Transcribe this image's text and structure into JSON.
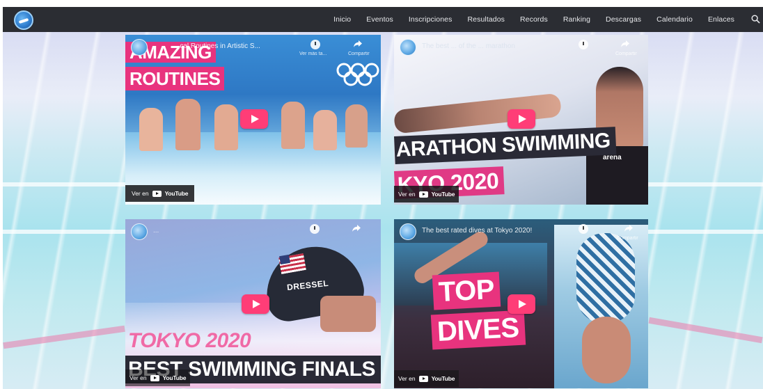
{
  "navbar": {
    "logo": "swim-federation-logo",
    "menu": [
      "Inicio",
      "Eventos",
      "Inscripciones",
      "Resultados",
      "Records",
      "Ranking",
      "Descargas",
      "Calendario",
      "Enlaces"
    ]
  },
  "videos": [
    {
      "title": "...cal Routines in Artistic S...",
      "clock_label": "Ver más ta...",
      "share_label": "Compartir",
      "headline_lines": [
        "AMAZING",
        "ROUTINES"
      ],
      "watch_on": "Ver en",
      "platform": "YouTube"
    },
    {
      "title": "The best ... of the ... marathon",
      "clock_label": "",
      "share_label": "Compartir",
      "headline_lines": [
        "ARATHON SWIMMING",
        "KYO 2020"
      ],
      "cap_text": "arena",
      "watch_on": "Ver en",
      "platform": "YouTube"
    },
    {
      "title": "...",
      "clock_label": "",
      "share_label": "",
      "cap_text": "DRESSEL",
      "headline_lines": [
        "TOKYO 2020",
        "BEST SWIMMING FINALS"
      ],
      "watch_on": "Ver en",
      "platform": "YouTube"
    },
    {
      "title": "The best rated dives at Tokyo 2020!",
      "clock_label": "",
      "share_label": "Compartir",
      "headline_lines": [
        "TOP",
        "DIVES"
      ],
      "watch_on": "Ver en",
      "platform": "YouTube"
    }
  ],
  "colors": {
    "nav_bg": "#2b2d33",
    "accent_pink": "#e8337e",
    "play_button": "#ff3d77"
  }
}
